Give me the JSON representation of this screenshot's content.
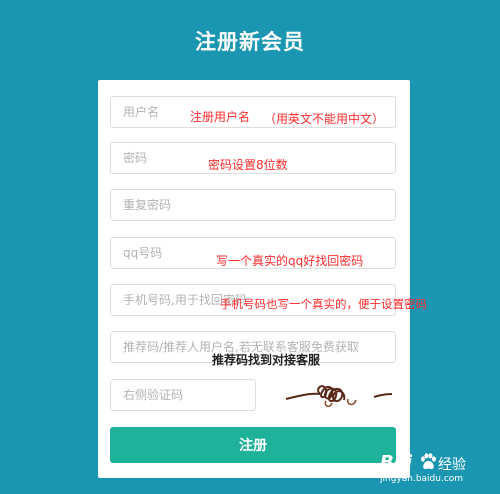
{
  "page": {
    "title": "注册新会员"
  },
  "form": {
    "username_placeholder": "用户名",
    "password_placeholder": "密码",
    "confirm_password_placeholder": "重复密码",
    "qq_placeholder": "qq号码",
    "phone_placeholder": "手机号码,用于找回密码",
    "referral_placeholder": "推荐码/推荐人用户名,若无联系客服免费获取",
    "captcha_placeholder": "右侧验证码",
    "submit_label": "注册"
  },
  "annotations": {
    "username_note": "注册用户名",
    "username_note_2": "（用英文不能用中文）",
    "password_note": "密码设置8位数",
    "qq_note": "写一个真实的qq好找回密码",
    "phone_note": "手机号码也写一个真实的，便于设置密码",
    "referral_note": "推荐码找到对接客服"
  },
  "watermark": {
    "logo": "Bai",
    "text": "经验",
    "url": "jingyan.baidu.com"
  },
  "colors": {
    "background": "#1a96b2",
    "submit": "#1fb29b",
    "annotation": "#ff2b2b"
  }
}
